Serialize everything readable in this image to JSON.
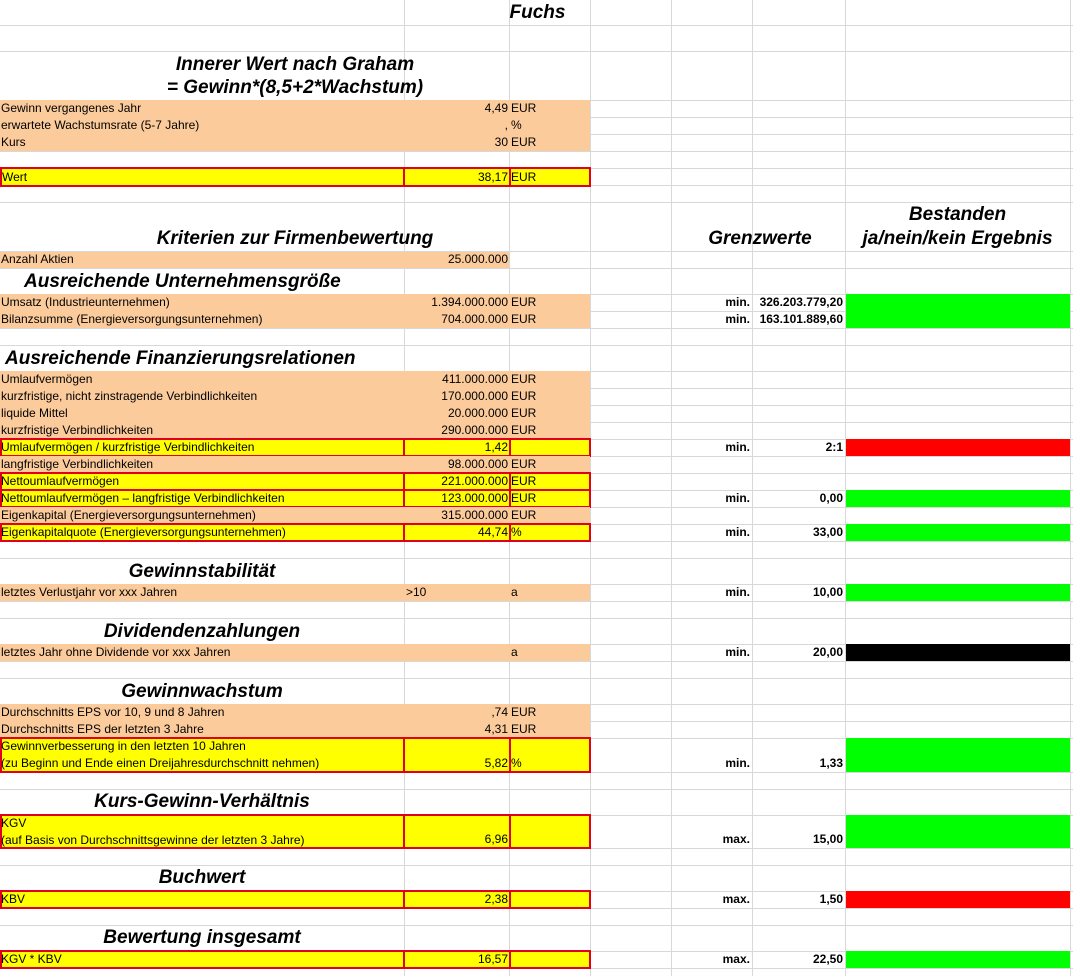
{
  "title": "Fuchs",
  "graham": {
    "heading1": "Innerer Wert nach Graham",
    "heading2": "= Gewinn*(8,5+2*Wachstum)",
    "rows": [
      {
        "label": "Gewinn vergangenes Jahr",
        "value": "4,49",
        "unit": "EUR"
      },
      {
        "label": "erwartete Wachstumsrate (5-7 Jahre)",
        "value": ",",
        "unit": "%"
      },
      {
        "label": "Kurs",
        "value": "30",
        "unit": "EUR"
      }
    ],
    "wert": {
      "label": "Wert",
      "value": "38,17",
      "unit": "EUR"
    }
  },
  "criteria_heading": "Kriterien zur Firmenbewertung",
  "grenzwerte_heading": "Grenzwerte",
  "bestanden_heading1": "Bestanden",
  "bestanden_heading2": "ja/nein/kein Ergebnis",
  "aktien": {
    "label": "Anzahl Aktien",
    "value": "25.000.000"
  },
  "sections": {
    "groesse": {
      "title": "Ausreichende Unternehmensgröße",
      "rows": [
        {
          "label": "Umsatz (Industrieunternehmen)",
          "value": "1.394.000.000",
          "unit": "EUR",
          "cmp": "min.",
          "limit": "326.203.779,20",
          "result": "green"
        },
        {
          "label": "Bilanzsumme (Energieversorgungsunternehmen)",
          "value": "704.000.000",
          "unit": "EUR",
          "cmp": "min.",
          "limit": "163.101.889,60",
          "result": "green"
        }
      ]
    },
    "finanz": {
      "title": "Ausreichende Finanzierungsrelationen",
      "rows": [
        {
          "label": "Umlaufvermögen",
          "value": "411.000.000",
          "unit": "EUR"
        },
        {
          "label": "kurzfristige, nicht zinstragende Verbindlichkeiten",
          "value": "170.000.000",
          "unit": "EUR"
        },
        {
          "label": "liquide Mittel",
          "value": "20.000.000",
          "unit": "EUR"
        },
        {
          "label": "kurzfristige Verbindlichkeiten",
          "value": "290.000.000",
          "unit": "EUR"
        },
        {
          "label": "Umlaufvermögen / kurzfristige Verbindlichkeiten",
          "value": "1,42",
          "unit": "",
          "cmp": "min.",
          "limit": "2:1",
          "result": "red"
        },
        {
          "label": "langfristige Verbindlichkeiten",
          "value": "98.000.000",
          "unit": "EUR"
        },
        {
          "label": "Nettoumlaufvermögen",
          "value": "221.000.000",
          "unit": "EUR"
        },
        {
          "label": "Nettoumlaufvermögen – langfristige Verbindlichkeiten",
          "value": "123.000.000",
          "unit": "EUR",
          "cmp": "min.",
          "limit": "0,00",
          "result": "green"
        },
        {
          "label": "Eigenkapital (Energieversorgungsunternehmen)",
          "value": "315.000.000",
          "unit": "EUR"
        },
        {
          "label": "Eigenkapitalquote (Energieversorgungsunternehmen)",
          "value": "44,74",
          "unit": "%",
          "cmp": "min.",
          "limit": "33,00",
          "result": "green"
        }
      ]
    },
    "stabil": {
      "title": "Gewinnstabilität",
      "rows": [
        {
          "label": "letztes Verlustjahr vor xxx Jahren",
          "value": ">10",
          "unit": "a",
          "cmp": "min.",
          "limit": "10,00",
          "result": "green"
        }
      ]
    },
    "dividende": {
      "title": "Dividendenzahlungen",
      "rows": [
        {
          "label": "letztes Jahr ohne Dividende vor xxx Jahren",
          "value": "",
          "unit": "a",
          "cmp": "min.",
          "limit": "20,00",
          "result": "black"
        }
      ]
    },
    "wachstum": {
      "title": "Gewinnwachstum",
      "rows": [
        {
          "label": "Durchschnitts EPS vor 10, 9 und 8 Jahren",
          "value": ",74",
          "unit": "EUR"
        },
        {
          "label": "Durchschnitts EPS der letzten 3 Jahre",
          "value": "4,31",
          "unit": "EUR"
        },
        {
          "label": "Gewinnverbesserung in den letzten 10 Jahren",
          "label2": "(zu Beginn und Ende einen Dreijahresdurchschnitt nehmen)",
          "value": "5,82",
          "unit": "%",
          "cmp": "min.",
          "limit": "1,33",
          "result": "green"
        }
      ]
    },
    "kgv": {
      "title": "Kurs-Gewinn-Verhältnis",
      "rows": [
        {
          "label": "KGV",
          "label2": "(auf Basis von Durchschnittsgewinne der letzten 3 Jahre)",
          "value": "6,96",
          "unit": "",
          "cmp": "max.",
          "limit": "15,00",
          "result": "green"
        }
      ]
    },
    "buchwert": {
      "title": "Buchwert",
      "rows": [
        {
          "label": "KBV",
          "value": "2,38",
          "unit": "",
          "cmp": "max.",
          "limit": "1,50",
          "result": "red"
        }
      ]
    },
    "gesamt": {
      "title": "Bewertung insgesamt",
      "rows": [
        {
          "label": "KGV * KBV",
          "value": "16,57",
          "unit": "",
          "cmp": "max.",
          "limit": "22,50",
          "result": "green"
        }
      ]
    }
  },
  "colors": {
    "peach": "#fbcb9c",
    "yellow": "#ffff00",
    "pass": "#00ff00",
    "fail": "#ff0000",
    "none": "#000000",
    "border": "#e0001c"
  }
}
